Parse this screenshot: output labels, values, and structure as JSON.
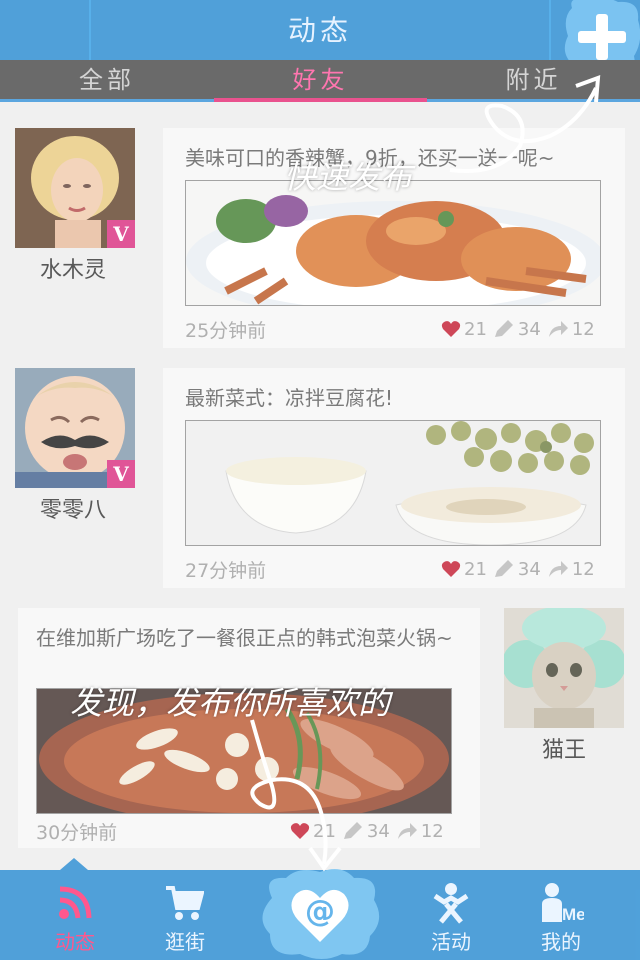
{
  "header": {
    "title": "动态"
  },
  "tabs": [
    {
      "label": "全部"
    },
    {
      "label": "好友"
    },
    {
      "label": "附近"
    }
  ],
  "active_tab": "好友",
  "posts": [
    {
      "user": "水木灵",
      "verified": true,
      "text": "美味可口的香辣蟹，9折，还买一送一呢~",
      "time": "25分钟前",
      "likes": "21",
      "comments": "34",
      "shares": "12"
    },
    {
      "user": "零零八",
      "verified": true,
      "text": "最新菜式：凉拌豆腐花!",
      "time": "27分钟前",
      "likes": "21",
      "comments": "34",
      "shares": "12"
    },
    {
      "user": "猫王",
      "verified": false,
      "text": "在维加斯广场吃了一餐很正点的韩式泡菜火锅~",
      "time": "30分钟前",
      "likes": "21",
      "comments": "34",
      "shares": "12"
    }
  ],
  "bottom_nav": [
    {
      "label": "动态",
      "icon": "rss-icon"
    },
    {
      "label": "逛街",
      "icon": "cart-icon"
    },
    {
      "label": "活动",
      "icon": "person-activity-icon"
    },
    {
      "label": "我的",
      "icon": "me-icon"
    }
  ],
  "hints": {
    "publish": "快速发布",
    "discover": "发现，发布你所喜欢的"
  },
  "colors": {
    "brand_blue": "#1f86cf",
    "accent_pink": "#e3226f",
    "tab_bar": "#404040",
    "like_red": "#c0142a"
  }
}
